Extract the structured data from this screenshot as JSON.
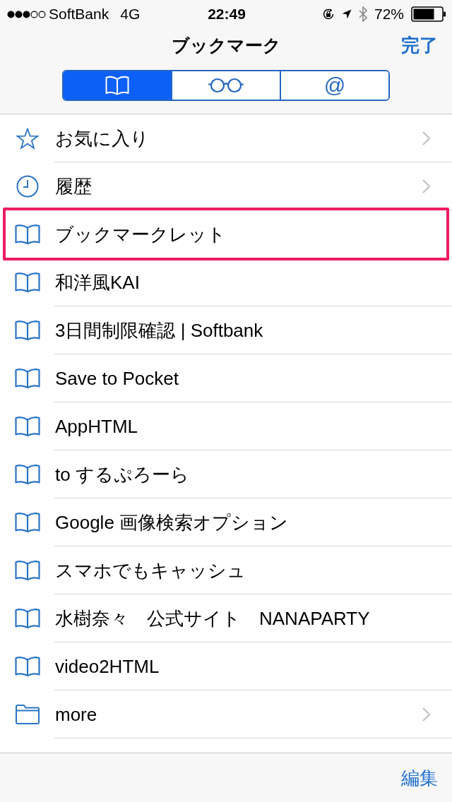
{
  "status_bar": {
    "carrier": "SoftBank",
    "network": "4G",
    "time": "22:49",
    "battery_text": "72%"
  },
  "nav_bar": {
    "title": "ブックマーク",
    "done_button": "完了"
  },
  "segments": [
    {
      "kind": "bookmarks",
      "selected": true
    },
    {
      "kind": "reading_list",
      "selected": false
    },
    {
      "kind": "symbol",
      "label": "@",
      "selected": false
    }
  ],
  "items": [
    {
      "kind": "favorites",
      "label": "お気に入り",
      "disclosure": true,
      "highlighted": false
    },
    {
      "kind": "history",
      "label": "履歴",
      "disclosure": true,
      "highlighted": false
    },
    {
      "kind": "bookmark",
      "label": "ブックマークレット",
      "disclosure": false,
      "highlighted": true
    },
    {
      "kind": "bookmark",
      "label": "和洋風KAI",
      "disclosure": false,
      "highlighted": false
    },
    {
      "kind": "bookmark",
      "label": "3日間制限確認 | Softbank",
      "disclosure": false,
      "highlighted": false
    },
    {
      "kind": "bookmark",
      "label": "Save to Pocket",
      "disclosure": false,
      "highlighted": false
    },
    {
      "kind": "bookmark",
      "label": "AppHTML",
      "disclosure": false,
      "highlighted": false
    },
    {
      "kind": "bookmark",
      "label": "to するぷろーら",
      "disclosure": false,
      "highlighted": false
    },
    {
      "kind": "bookmark",
      "label": "Google 画像検索オプション",
      "disclosure": false,
      "highlighted": false
    },
    {
      "kind": "bookmark",
      "label": "スマホでもキャッシュ",
      "disclosure": false,
      "highlighted": false
    },
    {
      "kind": "bookmark",
      "label": "水樹奈々　公式サイト　NANAPARTY",
      "disclosure": false,
      "highlighted": false
    },
    {
      "kind": "bookmark",
      "label": "video2HTML",
      "disclosure": false,
      "highlighted": false
    },
    {
      "kind": "folder",
      "label": "more",
      "disclosure": true,
      "highlighted": false
    }
  ],
  "toolbar": {
    "edit_button": "編集"
  }
}
